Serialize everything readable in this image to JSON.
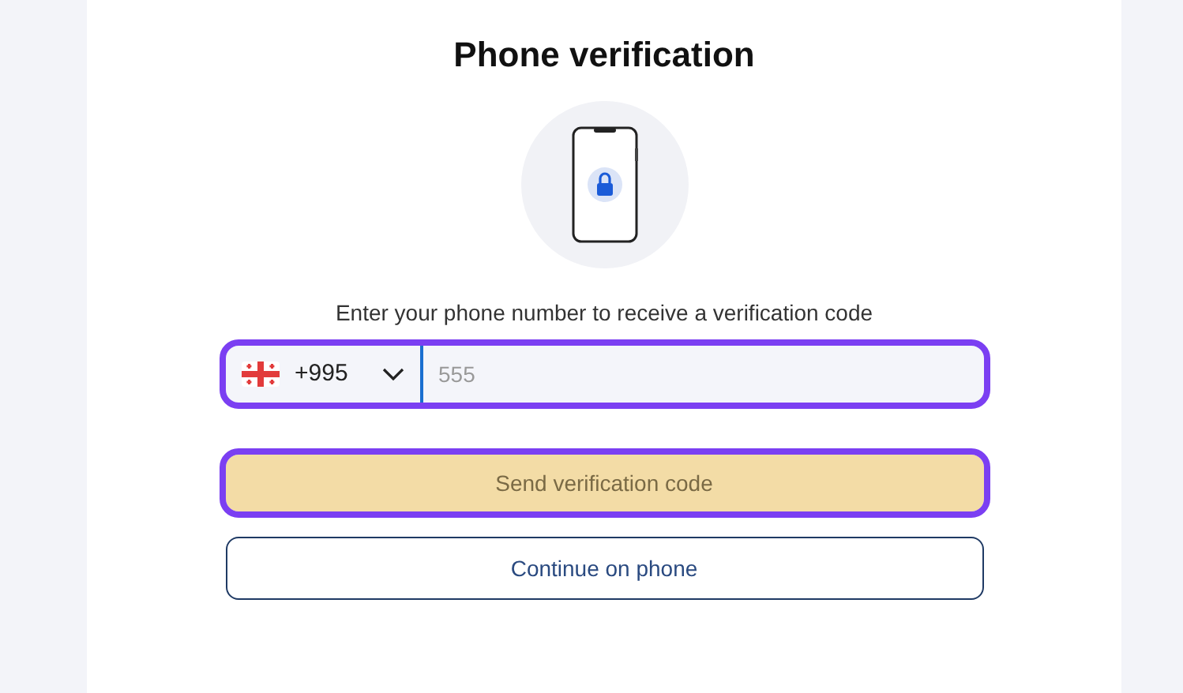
{
  "title": "Phone verification",
  "instruction": "Enter your phone number to receive a verification code",
  "phone": {
    "country_code": "+995",
    "placeholder": "555",
    "highlighted": true
  },
  "buttons": [
    {
      "kind": "primary",
      "label": "Send verification code",
      "disabled": true,
      "highlighted": true
    },
    {
      "kind": "outline",
      "label": "Continue on phone",
      "disabled": false,
      "highlighted": false
    }
  ]
}
